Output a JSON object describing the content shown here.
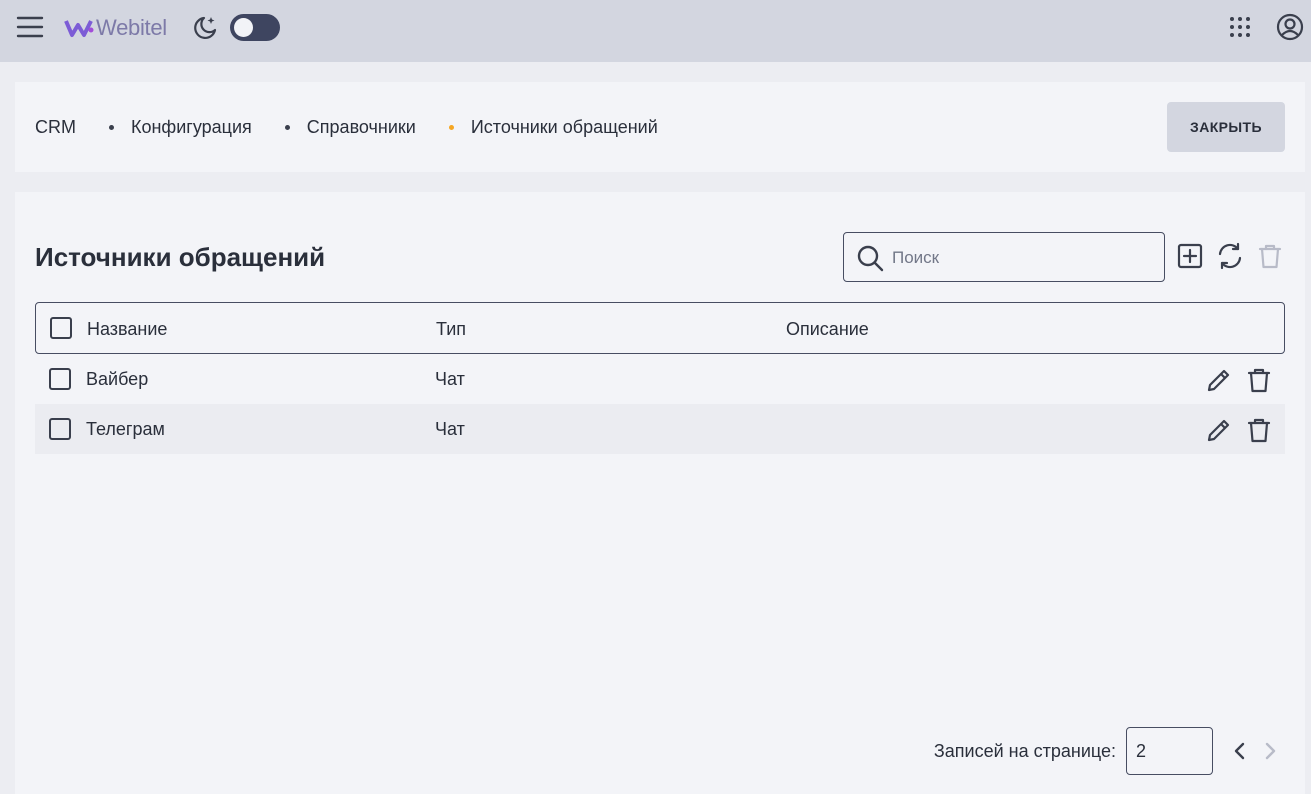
{
  "header": {
    "logo_text": "Webitel",
    "theme_toggle": "off"
  },
  "breadcrumb": {
    "items": [
      "CRM",
      "Конфигурация",
      "Справочники",
      "Источники обращений"
    ],
    "close_label": "ЗАКРЫТЬ",
    "active_dot_color": "#f5a623"
  },
  "page": {
    "title": "Источники обращений",
    "search_placeholder": "Поиск"
  },
  "table": {
    "columns": [
      "Название",
      "Тип",
      "Описание"
    ],
    "rows": [
      {
        "name": "Вайбер",
        "type": "Чат",
        "description": ""
      },
      {
        "name": "Телеграм",
        "type": "Чат",
        "description": ""
      }
    ]
  },
  "pagination": {
    "label": "Записей на странице:",
    "page_size": "2"
  },
  "colors": {
    "topbar": "#d3d6e0",
    "accent": "#7c5cd6",
    "text": "#2a2f3b",
    "disabled_icon": "#b8bbc8"
  }
}
